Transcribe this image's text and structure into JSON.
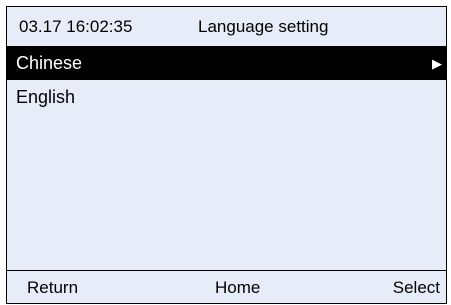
{
  "header": {
    "datetime": "03.17 16:02:35",
    "title": "Language setting"
  },
  "menu": {
    "items": [
      {
        "label": "Chinese",
        "selected": true,
        "arrow": "▶",
        "arrow_icon": "right-triangle-icon"
      },
      {
        "label": "English",
        "selected": false
      }
    ]
  },
  "footer": {
    "return_label": "Return",
    "home_label": "Home",
    "select_label": "Select"
  },
  "colors": {
    "screen_background": "#e7edf8",
    "selection_background": "#000000",
    "selection_text": "#ffffff",
    "text": "#000000"
  }
}
